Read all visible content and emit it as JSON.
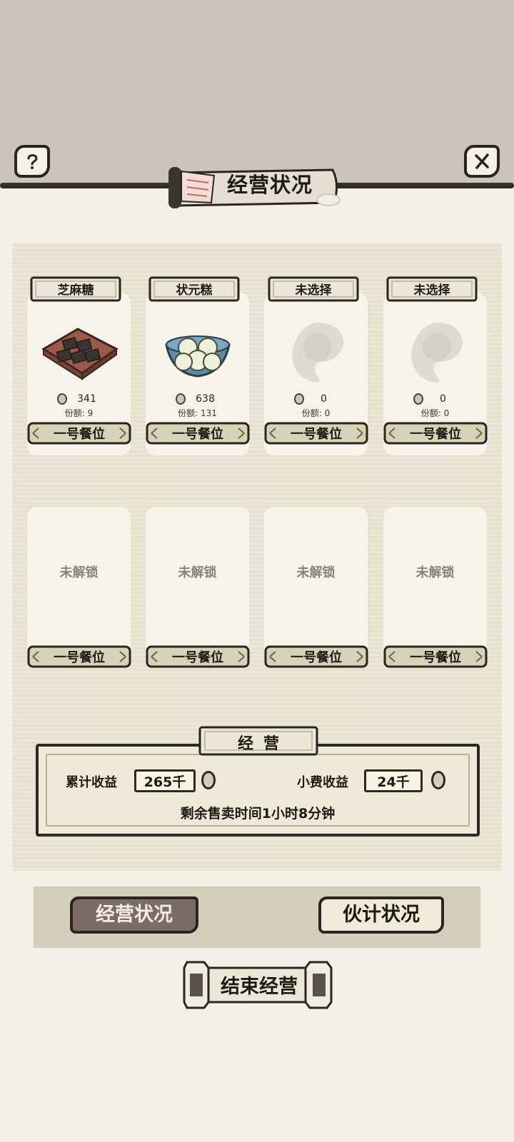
{
  "header": {
    "title": "经营状况"
  },
  "slots": [
    {
      "name": "芝麻糖",
      "dish_icon": "sesame-candy-icon",
      "coin_value": "341",
      "share": "份额: 9",
      "seat": "一号餐位"
    },
    {
      "name": "状元糕",
      "dish_icon": "zhuangyuan-cake-icon",
      "coin_value": "638",
      "share": "份额: 131",
      "seat": "一号餐位"
    },
    {
      "name": "未选择",
      "dish_icon": "empty-dish-icon",
      "coin_value": "0",
      "share": "份额: 0",
      "seat": "一号餐位"
    },
    {
      "name": "未选择",
      "dish_icon": "empty-dish-icon",
      "coin_value": "0",
      "share": "份额: 0",
      "seat": "一号餐位"
    }
  ],
  "locked_slots": [
    {
      "label": "未解锁",
      "seat": "一号餐位"
    },
    {
      "label": "未解锁",
      "seat": "一号餐位"
    },
    {
      "label": "未解锁",
      "seat": "一号餐位"
    },
    {
      "label": "未解锁",
      "seat": "一号餐位"
    }
  ],
  "business": {
    "title": "经营",
    "total_label": "累计收益",
    "total_value": "265千",
    "tip_label": "小费收益",
    "tip_value": "24千",
    "remaining": "剩余售卖时间1小时8分钟"
  },
  "tabs": {
    "active": "经营状况",
    "inactive": "伙计状况"
  },
  "end_button": "结束经营",
  "colors": {
    "accent_tab": "#7d6c66",
    "ink": "#2a2520",
    "paper": "#f4f0e6"
  }
}
